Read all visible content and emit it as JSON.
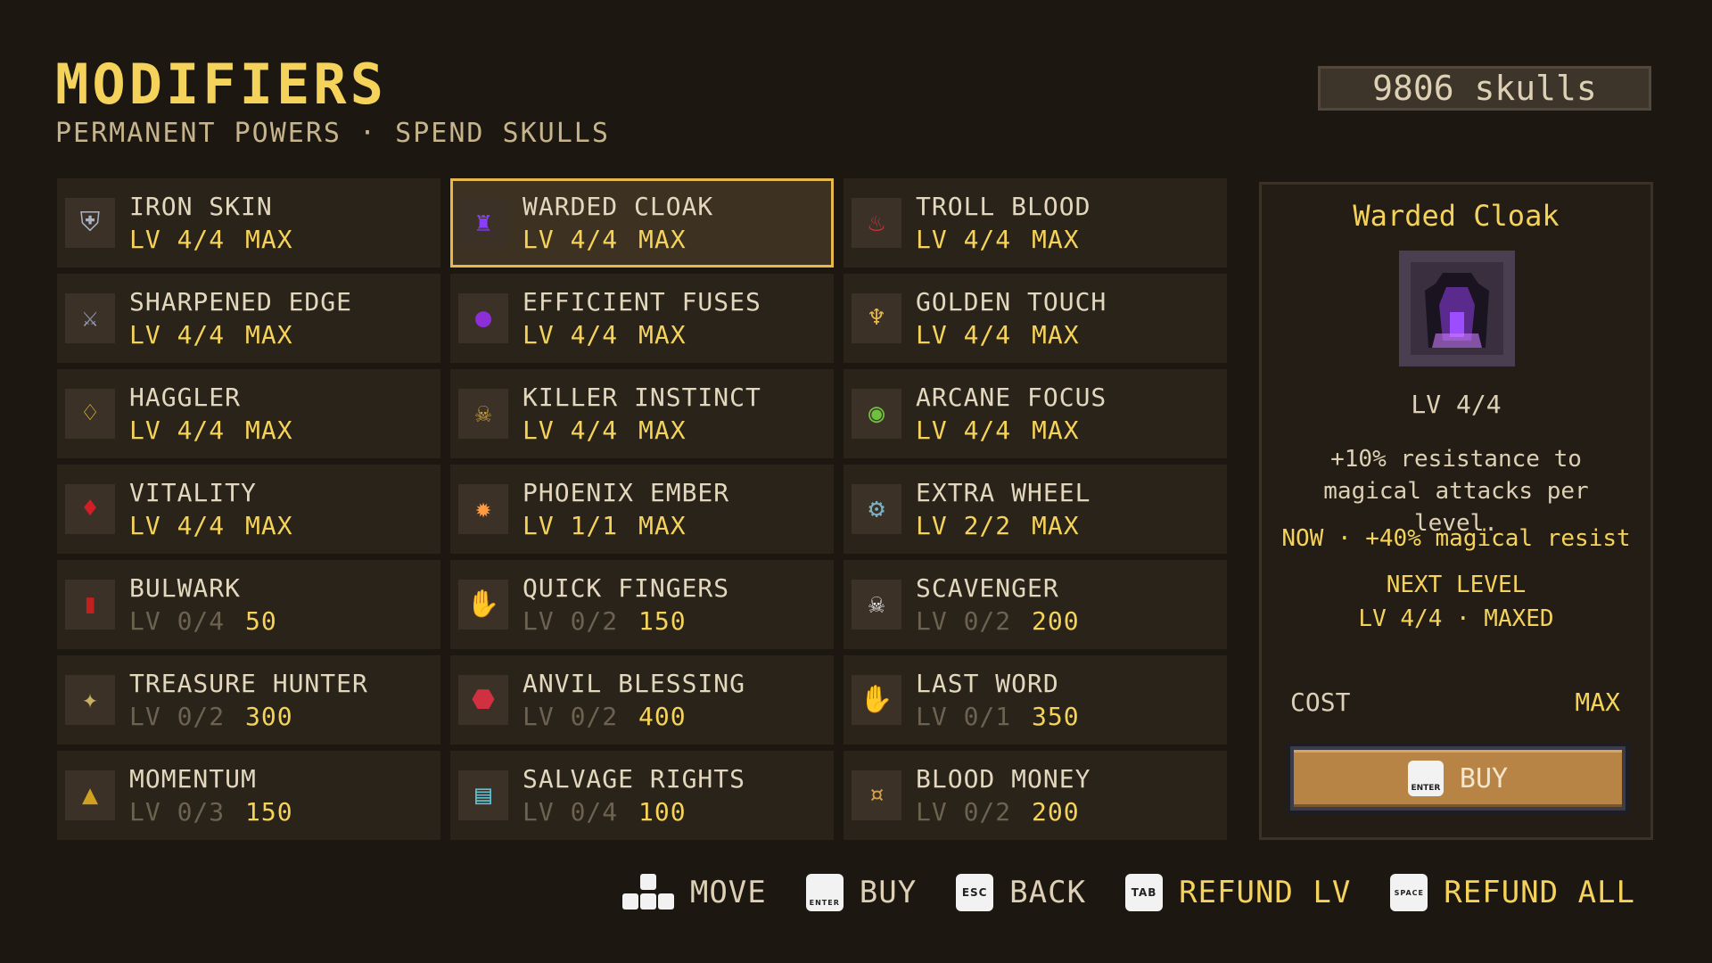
{
  "header": {
    "title": "MODIFIERS",
    "subtitle": "PERMANENT POWERS · SPEND SKULLS",
    "skulls": "9806 skulls"
  },
  "modifiers": [
    {
      "name": "IRON SKIN",
      "level": "LV 4/4",
      "value": "MAX",
      "owned": true,
      "icon": "armor-icon"
    },
    {
      "name": "WARDED CLOAK",
      "level": "LV 4/4",
      "value": "MAX",
      "owned": true,
      "icon": "cloak-icon",
      "selected": true
    },
    {
      "name": "TROLL BLOOD",
      "level": "LV 4/4",
      "value": "MAX",
      "owned": true,
      "icon": "potion-icon"
    },
    {
      "name": "SHARPENED EDGE",
      "level": "LV 4/4",
      "value": "MAX",
      "owned": true,
      "icon": "sword-icon"
    },
    {
      "name": "EFFICIENT FUSES",
      "level": "LV 4/4",
      "value": "MAX",
      "owned": true,
      "icon": "bomb-icon"
    },
    {
      "name": "GOLDEN TOUCH",
      "level": "LV 4/4",
      "value": "MAX",
      "owned": true,
      "icon": "chalice-icon"
    },
    {
      "name": "HAGGLER",
      "level": "LV 4/4",
      "value": "MAX",
      "owned": true,
      "icon": "purse-icon"
    },
    {
      "name": "KILLER INSTINCT",
      "level": "LV 4/4",
      "value": "MAX",
      "owned": true,
      "icon": "assassin-icon"
    },
    {
      "name": "ARCANE FOCUS",
      "level": "LV 4/4",
      "value": "MAX",
      "owned": true,
      "icon": "eye-icon"
    },
    {
      "name": "VITALITY",
      "level": "LV 4/4",
      "value": "MAX",
      "owned": true,
      "icon": "blood-shield-icon"
    },
    {
      "name": "PHOENIX EMBER",
      "level": "LV 1/1",
      "value": "MAX",
      "owned": true,
      "icon": "phoenix-icon"
    },
    {
      "name": "EXTRA WHEEL",
      "level": "LV 2/2",
      "value": "MAX",
      "owned": true,
      "icon": "gears-icon"
    },
    {
      "name": "BULWARK",
      "level": "LV 0/4",
      "value": "50",
      "owned": false,
      "icon": "tower-shield-icon"
    },
    {
      "name": "QUICK FINGERS",
      "level": "LV 0/2",
      "value": "150",
      "owned": false,
      "icon": "hand-icon"
    },
    {
      "name": "SCAVENGER",
      "level": "LV 0/2",
      "value": "200",
      "owned": false,
      "icon": "skull-icon"
    },
    {
      "name": "TREASURE HUNTER",
      "level": "LV 0/2",
      "value": "300",
      "owned": false,
      "icon": "map-icon"
    },
    {
      "name": "ANVIL BLESSING",
      "level": "LV 0/2",
      "value": "400",
      "owned": false,
      "icon": "anvil-icon"
    },
    {
      "name": "LAST WORD",
      "level": "LV 0/1",
      "value": "350",
      "owned": false,
      "icon": "zombie-hand-icon"
    },
    {
      "name": "MOMENTUM",
      "level": "LV 0/3",
      "value": "150",
      "owned": false,
      "icon": "boot-icon"
    },
    {
      "name": "SALVAGE RIGHTS",
      "level": "LV 0/4",
      "value": "100",
      "owned": false,
      "icon": "scrap-icon"
    },
    {
      "name": "BLOOD MONEY",
      "level": "LV 0/2",
      "value": "200",
      "owned": false,
      "icon": "coin-hand-icon"
    }
  ],
  "detail": {
    "name": "Warded Cloak",
    "icon": "cloak-icon",
    "level": "LV 4/4",
    "description": "+10% resistance to magical attacks per level.",
    "now": "NOW · +40% magical resist",
    "next_label": "NEXT LEVEL",
    "next_value": "LV 4/4 · MAXED",
    "cost_label": "COST",
    "cost_value": "MAX",
    "buy_key": "ENTER",
    "buy_label": "BUY"
  },
  "hints": {
    "move": "MOVE",
    "buy_key": "ENTER",
    "buy": "BUY",
    "back_key": "ESC",
    "back": "BACK",
    "refund_lv_key": "TAB",
    "refund_lv": "REFUND LV",
    "refund_all_key": "SPACE",
    "refund_all": "REFUND ALL"
  },
  "colors": {
    "background": "#1c1711",
    "accent_gold": "#f5d35a",
    "selection_border": "#e8b84a",
    "muted_text": "#6d6250",
    "buy_button": "#b88446"
  }
}
